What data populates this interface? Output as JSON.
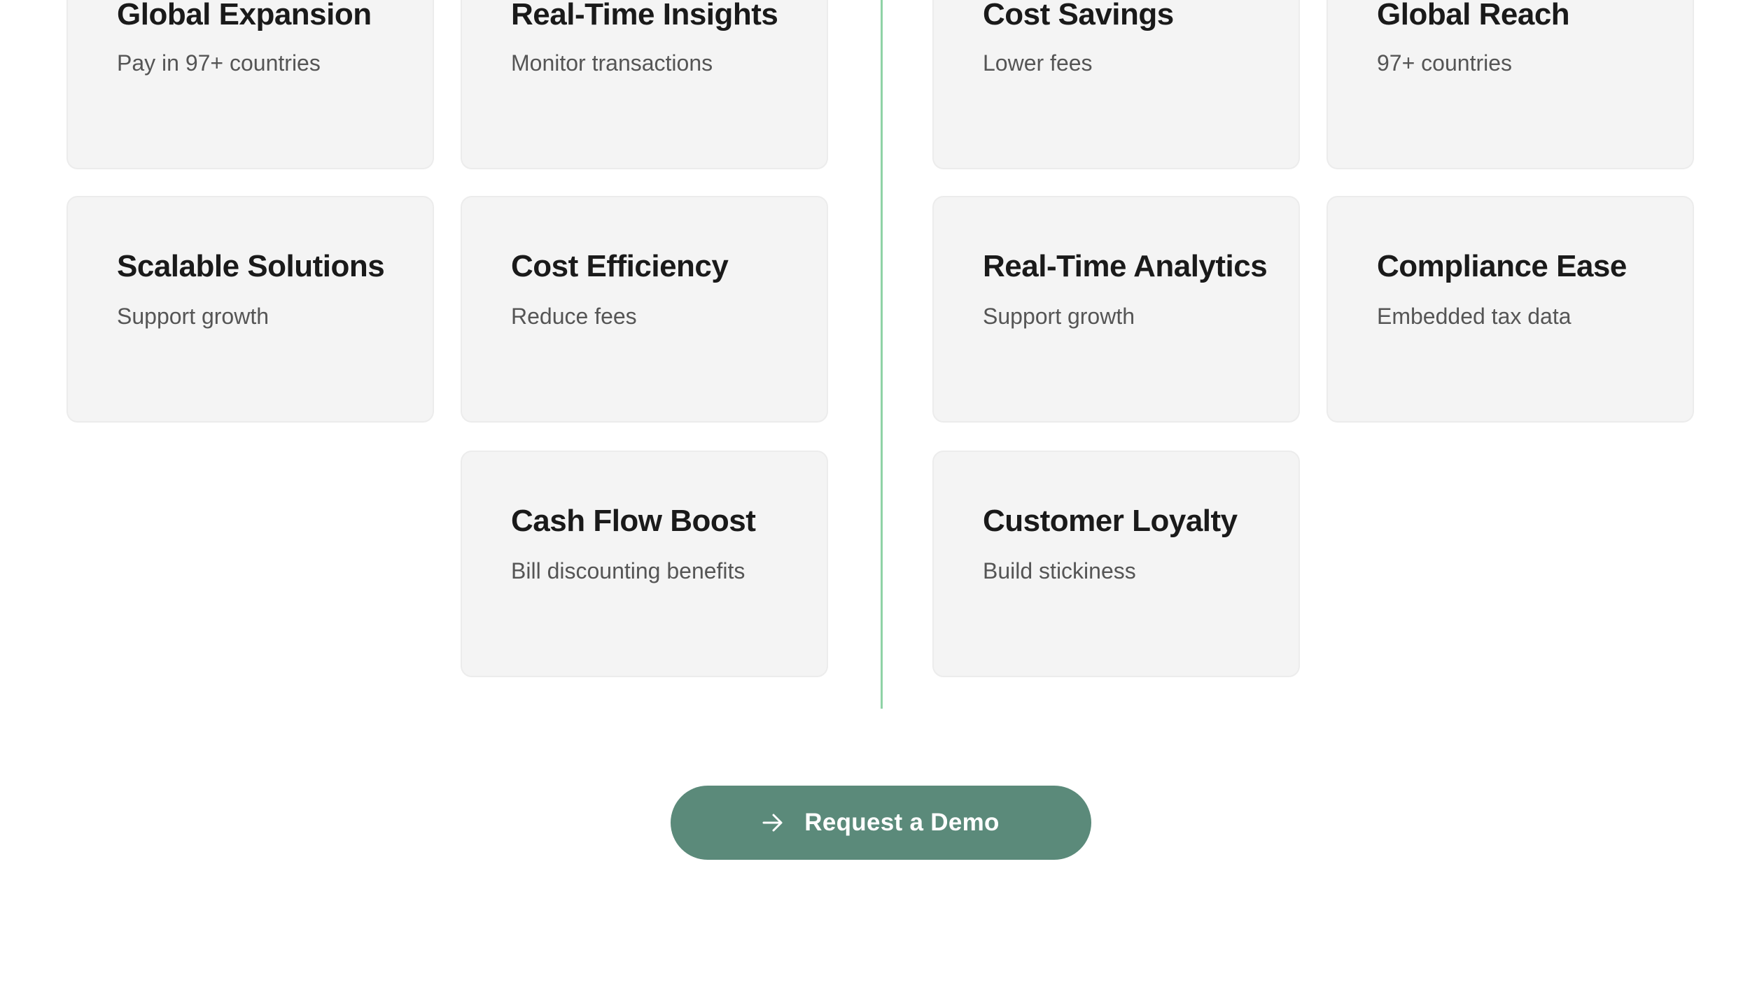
{
  "features_left": {
    "cards": [
      {
        "title": "Global Expansion",
        "description": "Pay in 97+ countries"
      },
      {
        "title": "Real-Time Insights",
        "description": "Monitor transactions"
      },
      {
        "title": "Scalable Solutions",
        "description": "Support growth"
      },
      {
        "title": "Cost Efficiency",
        "description": "Reduce fees"
      },
      {
        "title": "Cash Flow Boost",
        "description": "Bill discounting benefits"
      }
    ]
  },
  "features_right": {
    "cards": [
      {
        "title": "Cost Savings",
        "description": "Lower fees"
      },
      {
        "title": "Global Reach",
        "description": "97+ countries"
      },
      {
        "title": "Real-Time Analytics",
        "description": "Support growth"
      },
      {
        "title": "Compliance Ease",
        "description": "Embedded tax data"
      },
      {
        "title": "Customer Loyalty",
        "description": "Build stickiness"
      }
    ]
  },
  "cta": {
    "label": "Request a Demo",
    "icon": "arrow-right-icon"
  },
  "colors": {
    "card_background": "#f4f4f4",
    "divider": "#8fd3a6",
    "cta_background": "#5b8a7a",
    "title_text": "#1a1a1a",
    "description_text": "#555555"
  }
}
